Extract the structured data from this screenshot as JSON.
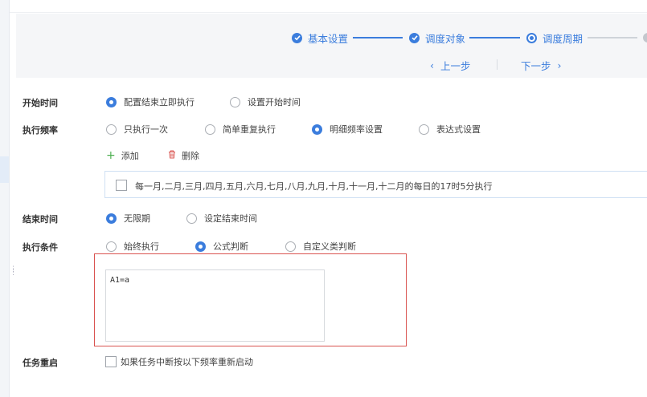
{
  "steps": [
    {
      "label": "基本设置",
      "state": "done"
    },
    {
      "label": "调度对象",
      "state": "done"
    },
    {
      "label": "调度周期",
      "state": "active"
    }
  ],
  "nav": {
    "prev": "上一步",
    "next": "下一步"
  },
  "start_time": {
    "label": "开始时间",
    "options": [
      {
        "label": "配置结束立即执行",
        "selected": true
      },
      {
        "label": "设置开始时间",
        "selected": false
      }
    ]
  },
  "frequency": {
    "label": "执行频率",
    "options": [
      {
        "label": "只执行一次",
        "selected": false
      },
      {
        "label": "简单重复执行",
        "selected": false
      },
      {
        "label": "明细频率设置",
        "selected": true
      },
      {
        "label": "表达式设置",
        "selected": false
      }
    ],
    "add_label": "添加",
    "delete_label": "删除",
    "rule_text": "每一月,二月,三月,四月,五月,六月,七月,八月,九月,十月,十一月,十二月的每日的17时5分执行"
  },
  "end_time": {
    "label": "结束时间",
    "options": [
      {
        "label": "无限期",
        "selected": true
      },
      {
        "label": "设定结束时间",
        "selected": false
      }
    ]
  },
  "condition": {
    "label": "执行条件",
    "options": [
      {
        "label": "始终执行",
        "selected": false
      },
      {
        "label": "公式判断",
        "selected": true
      },
      {
        "label": "自定义类判断",
        "selected": false
      }
    ],
    "formula": "A1=a"
  },
  "restart": {
    "label": "任务重启",
    "checkbox_label": "如果任务中断按以下频率重新启动"
  },
  "colors": {
    "accent": "#3b7ddd",
    "highlight": "#d9534f"
  }
}
